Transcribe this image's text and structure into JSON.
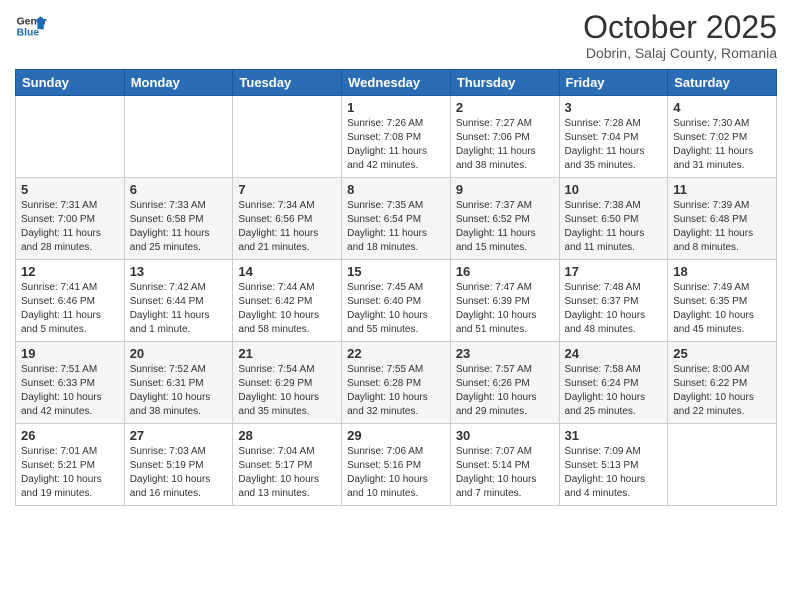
{
  "logo": {
    "line1": "General",
    "line2": "Blue"
  },
  "title": "October 2025",
  "subtitle": "Dobrin, Salaj County, Romania",
  "days_header": [
    "Sunday",
    "Monday",
    "Tuesday",
    "Wednesday",
    "Thursday",
    "Friday",
    "Saturday"
  ],
  "weeks": [
    [
      {
        "day": "",
        "info": ""
      },
      {
        "day": "",
        "info": ""
      },
      {
        "day": "",
        "info": ""
      },
      {
        "day": "1",
        "info": "Sunrise: 7:26 AM\nSunset: 7:08 PM\nDaylight: 11 hours and 42 minutes."
      },
      {
        "day": "2",
        "info": "Sunrise: 7:27 AM\nSunset: 7:06 PM\nDaylight: 11 hours and 38 minutes."
      },
      {
        "day": "3",
        "info": "Sunrise: 7:28 AM\nSunset: 7:04 PM\nDaylight: 11 hours and 35 minutes."
      },
      {
        "day": "4",
        "info": "Sunrise: 7:30 AM\nSunset: 7:02 PM\nDaylight: 11 hours and 31 minutes."
      }
    ],
    [
      {
        "day": "5",
        "info": "Sunrise: 7:31 AM\nSunset: 7:00 PM\nDaylight: 11 hours and 28 minutes."
      },
      {
        "day": "6",
        "info": "Sunrise: 7:33 AM\nSunset: 6:58 PM\nDaylight: 11 hours and 25 minutes."
      },
      {
        "day": "7",
        "info": "Sunrise: 7:34 AM\nSunset: 6:56 PM\nDaylight: 11 hours and 21 minutes."
      },
      {
        "day": "8",
        "info": "Sunrise: 7:35 AM\nSunset: 6:54 PM\nDaylight: 11 hours and 18 minutes."
      },
      {
        "day": "9",
        "info": "Sunrise: 7:37 AM\nSunset: 6:52 PM\nDaylight: 11 hours and 15 minutes."
      },
      {
        "day": "10",
        "info": "Sunrise: 7:38 AM\nSunset: 6:50 PM\nDaylight: 11 hours and 11 minutes."
      },
      {
        "day": "11",
        "info": "Sunrise: 7:39 AM\nSunset: 6:48 PM\nDaylight: 11 hours and 8 minutes."
      }
    ],
    [
      {
        "day": "12",
        "info": "Sunrise: 7:41 AM\nSunset: 6:46 PM\nDaylight: 11 hours and 5 minutes."
      },
      {
        "day": "13",
        "info": "Sunrise: 7:42 AM\nSunset: 6:44 PM\nDaylight: 11 hours and 1 minute."
      },
      {
        "day": "14",
        "info": "Sunrise: 7:44 AM\nSunset: 6:42 PM\nDaylight: 10 hours and 58 minutes."
      },
      {
        "day": "15",
        "info": "Sunrise: 7:45 AM\nSunset: 6:40 PM\nDaylight: 10 hours and 55 minutes."
      },
      {
        "day": "16",
        "info": "Sunrise: 7:47 AM\nSunset: 6:39 PM\nDaylight: 10 hours and 51 minutes."
      },
      {
        "day": "17",
        "info": "Sunrise: 7:48 AM\nSunset: 6:37 PM\nDaylight: 10 hours and 48 minutes."
      },
      {
        "day": "18",
        "info": "Sunrise: 7:49 AM\nSunset: 6:35 PM\nDaylight: 10 hours and 45 minutes."
      }
    ],
    [
      {
        "day": "19",
        "info": "Sunrise: 7:51 AM\nSunset: 6:33 PM\nDaylight: 10 hours and 42 minutes."
      },
      {
        "day": "20",
        "info": "Sunrise: 7:52 AM\nSunset: 6:31 PM\nDaylight: 10 hours and 38 minutes."
      },
      {
        "day": "21",
        "info": "Sunrise: 7:54 AM\nSunset: 6:29 PM\nDaylight: 10 hours and 35 minutes."
      },
      {
        "day": "22",
        "info": "Sunrise: 7:55 AM\nSunset: 6:28 PM\nDaylight: 10 hours and 32 minutes."
      },
      {
        "day": "23",
        "info": "Sunrise: 7:57 AM\nSunset: 6:26 PM\nDaylight: 10 hours and 29 minutes."
      },
      {
        "day": "24",
        "info": "Sunrise: 7:58 AM\nSunset: 6:24 PM\nDaylight: 10 hours and 25 minutes."
      },
      {
        "day": "25",
        "info": "Sunrise: 8:00 AM\nSunset: 6:22 PM\nDaylight: 10 hours and 22 minutes."
      }
    ],
    [
      {
        "day": "26",
        "info": "Sunrise: 7:01 AM\nSunset: 5:21 PM\nDaylight: 10 hours and 19 minutes."
      },
      {
        "day": "27",
        "info": "Sunrise: 7:03 AM\nSunset: 5:19 PM\nDaylight: 10 hours and 16 minutes."
      },
      {
        "day": "28",
        "info": "Sunrise: 7:04 AM\nSunset: 5:17 PM\nDaylight: 10 hours and 13 minutes."
      },
      {
        "day": "29",
        "info": "Sunrise: 7:06 AM\nSunset: 5:16 PM\nDaylight: 10 hours and 10 minutes."
      },
      {
        "day": "30",
        "info": "Sunrise: 7:07 AM\nSunset: 5:14 PM\nDaylight: 10 hours and 7 minutes."
      },
      {
        "day": "31",
        "info": "Sunrise: 7:09 AM\nSunset: 5:13 PM\nDaylight: 10 hours and 4 minutes."
      },
      {
        "day": "",
        "info": ""
      }
    ]
  ]
}
